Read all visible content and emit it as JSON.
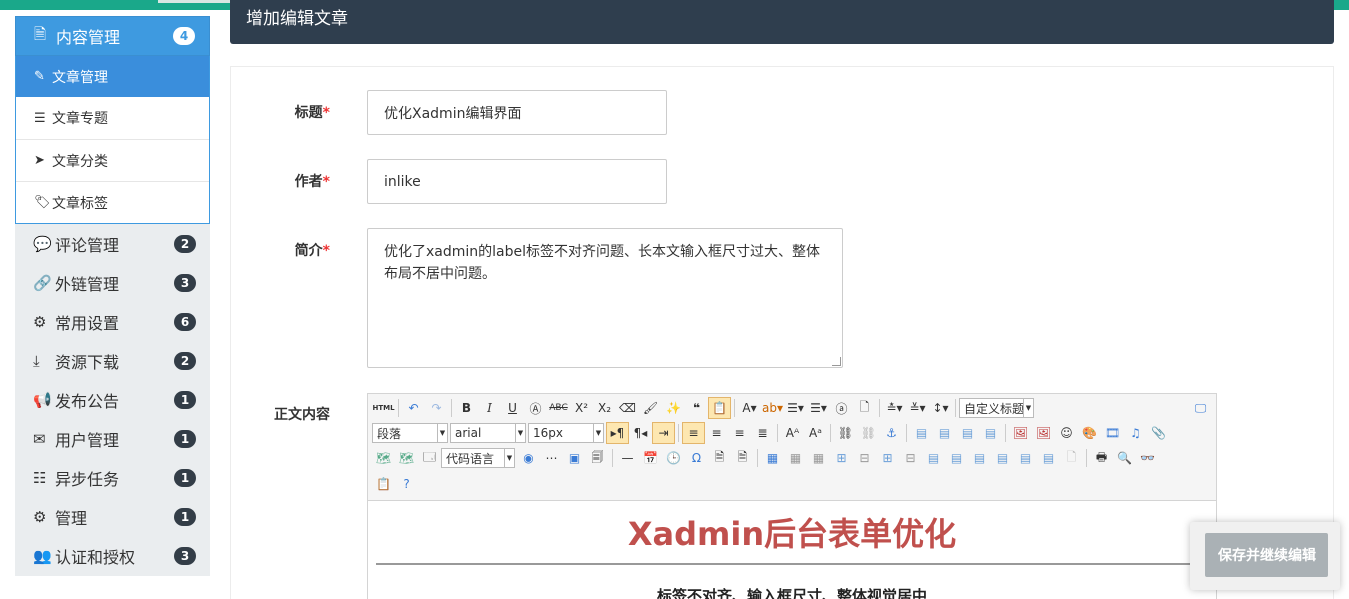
{
  "page": {
    "header_title": "增加编辑文章"
  },
  "sidebar": {
    "group": {
      "title": "内容管理",
      "badge": "4"
    },
    "sub_items": [
      {
        "label": "文章管理",
        "icon": "pencil-icon"
      },
      {
        "label": "文章专题",
        "icon": "list-icon"
      },
      {
        "label": "文章分类",
        "icon": "location-arrow-icon"
      },
      {
        "label": "文章标签",
        "icon": "tag-icon"
      }
    ],
    "items": [
      {
        "label": "评论管理",
        "badge": "2",
        "icon": "comments-icon"
      },
      {
        "label": "外链管理",
        "badge": "3",
        "icon": "link-icon"
      },
      {
        "label": "常用设置",
        "badge": "6",
        "icon": "cogs-icon"
      },
      {
        "label": "资源下载",
        "badge": "2",
        "icon": "download-icon"
      },
      {
        "label": "发布公告",
        "badge": "1",
        "icon": "bullhorn-icon"
      },
      {
        "label": "用户管理",
        "badge": "1",
        "icon": "envelope-icon"
      },
      {
        "label": "异步任务",
        "badge": "1",
        "icon": "tasks-icon"
      },
      {
        "label": "管理",
        "badge": "1",
        "icon": "cog-icon"
      },
      {
        "label": "认证和授权",
        "badge": "3",
        "icon": "users-icon"
      }
    ]
  },
  "form": {
    "title_label": "标题",
    "title_value": "优化Xadmin编辑界面",
    "author_label": "作者",
    "author_value": "inlike",
    "summary_label": "简介",
    "summary_value": "优化了xadmin的label标签不对齐问题、长本文输入框尺寸过大、整体布局不居中问题。",
    "body_label": "正文内容",
    "required_mark": "*"
  },
  "editor": {
    "html_btn": "HTML",
    "custom_title": "自定义标题",
    "paragraph": "段落",
    "font_family": "arial",
    "font_size": "16px",
    "code_lang": "代码语言",
    "content_title": "Xadmin后台表单优化",
    "content_subtitle": "标签不对齐、输入框尺寸、整体视觉居中"
  },
  "actions": {
    "save_continue": "保存并继续编辑"
  }
}
